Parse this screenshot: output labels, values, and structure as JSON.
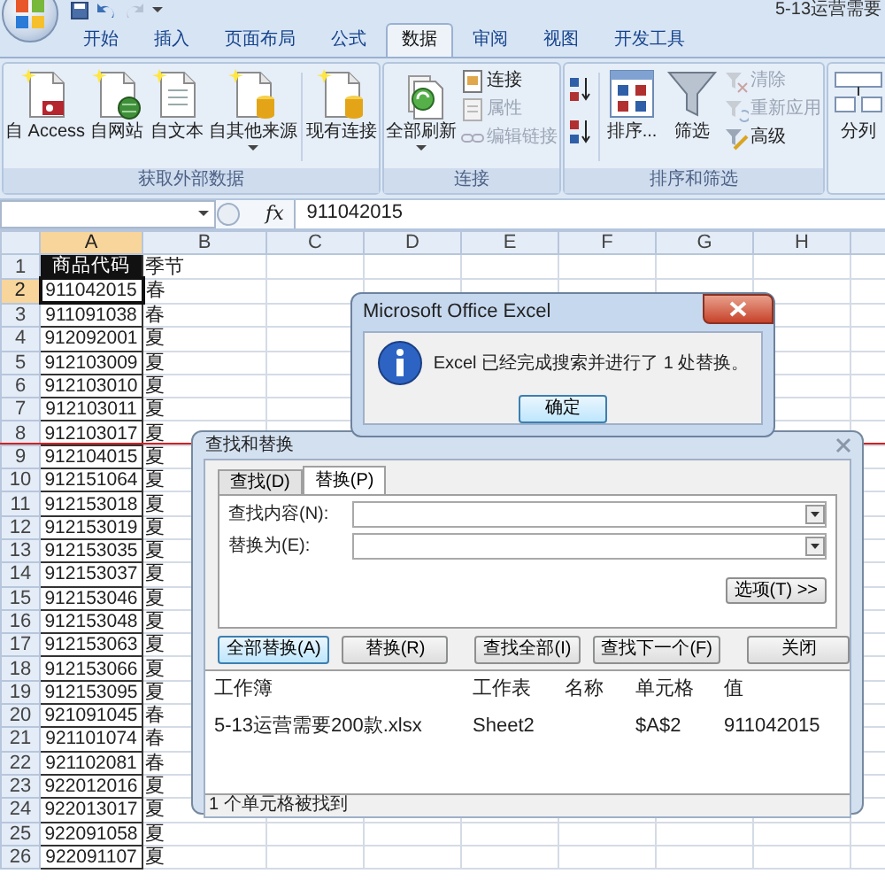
{
  "title_bar": {
    "title": "5-13运营需要"
  },
  "ribbon": {
    "tabs": [
      {
        "label": "开始",
        "selected": false
      },
      {
        "label": "插入",
        "selected": false
      },
      {
        "label": "页面布局",
        "selected": false
      },
      {
        "label": "公式",
        "selected": false
      },
      {
        "label": "数据",
        "selected": true
      },
      {
        "label": "审阅",
        "selected": false
      },
      {
        "label": "视图",
        "selected": false
      },
      {
        "label": "开发工具",
        "selected": false
      }
    ],
    "groups": [
      {
        "label": "获取外部数据",
        "items": [
          {
            "kind": "large",
            "label": "自 Access",
            "dropdown": false
          },
          {
            "kind": "large",
            "label": "自网站",
            "dropdown": false
          },
          {
            "kind": "large",
            "label": "自文本",
            "dropdown": false
          },
          {
            "kind": "large",
            "label": "自其他来源",
            "dropdown": true
          },
          {
            "kind": "large",
            "label": "现有连接",
            "dropdown": false
          }
        ]
      },
      {
        "label": "连接",
        "items": [
          {
            "kind": "large",
            "label": "全部刷新",
            "dropdown": true
          },
          {
            "kind": "stack",
            "items": [
              {
                "label": "连接",
                "disabled": false
              },
              {
                "label": "属性",
                "disabled": true
              },
              {
                "label": "编辑链接",
                "disabled": true
              }
            ]
          }
        ]
      },
      {
        "label": "排序和筛选",
        "items": [
          {
            "kind": "sortpair"
          },
          {
            "kind": "large",
            "label": "排序...",
            "dropdown": false
          },
          {
            "kind": "large",
            "label": "筛选",
            "dropdown": false
          },
          {
            "kind": "stack",
            "items": [
              {
                "label": "清除",
                "disabled": true
              },
              {
                "label": "重新应用",
                "disabled": true
              },
              {
                "label": "高级",
                "disabled": false
              }
            ]
          }
        ]
      },
      {
        "items": [
          {
            "kind": "large",
            "label": "分列",
            "dropdown": false
          }
        ]
      }
    ]
  },
  "formula_bar": {
    "fx_label": "fx",
    "value": "911042015"
  },
  "sheet": {
    "columns": [
      {
        "label": "A",
        "selected": true
      },
      {
        "label": "B",
        "selected": false
      },
      {
        "label": "C",
        "selected": false
      },
      {
        "label": "D",
        "selected": false
      },
      {
        "label": "E",
        "selected": false
      },
      {
        "label": "F",
        "selected": false
      },
      {
        "label": "G",
        "selected": false
      },
      {
        "label": "H",
        "selected": false
      }
    ],
    "rows": [
      {
        "number": "1",
        "kind": "header",
        "selected": false,
        "cells": [
          "商品代码",
          "季节"
        ]
      },
      {
        "number": "2",
        "kind": "data",
        "selected": true,
        "cells": [
          "911042015",
          "春"
        ]
      },
      {
        "number": "3",
        "kind": "data",
        "selected": false,
        "cells": [
          "911091038",
          "春"
        ]
      },
      {
        "number": "4",
        "kind": "data",
        "selected": false,
        "cells": [
          "912092001",
          "夏"
        ]
      },
      {
        "number": "5",
        "kind": "data",
        "selected": false,
        "cells": [
          "912103009",
          "夏"
        ]
      },
      {
        "number": "6",
        "kind": "data",
        "selected": false,
        "cells": [
          "912103010",
          "夏"
        ]
      },
      {
        "number": "7",
        "kind": "data",
        "selected": false,
        "cells": [
          "912103011",
          "夏"
        ]
      },
      {
        "number": "8",
        "kind": "data",
        "selected": false,
        "cells": [
          "912103017",
          "夏"
        ]
      },
      {
        "number": "9",
        "kind": "data",
        "selected": false,
        "cells": [
          "912104015",
          "夏"
        ]
      },
      {
        "number": "10",
        "kind": "data",
        "selected": false,
        "cells": [
          "912151064",
          "夏"
        ]
      },
      {
        "number": "11",
        "kind": "data",
        "selected": false,
        "cells": [
          "912153018",
          "夏"
        ]
      },
      {
        "number": "12",
        "kind": "data",
        "selected": false,
        "cells": [
          "912153019",
          "夏"
        ]
      },
      {
        "number": "13",
        "kind": "data",
        "selected": false,
        "cells": [
          "912153035",
          "夏"
        ]
      },
      {
        "number": "14",
        "kind": "data",
        "selected": false,
        "cells": [
          "912153037",
          "夏"
        ]
      },
      {
        "number": "15",
        "kind": "data",
        "selected": false,
        "cells": [
          "912153046",
          "夏"
        ]
      },
      {
        "number": "16",
        "kind": "data",
        "selected": false,
        "cells": [
          "912153048",
          "夏"
        ]
      },
      {
        "number": "17",
        "kind": "data",
        "selected": false,
        "cells": [
          "912153063",
          "夏"
        ]
      },
      {
        "number": "18",
        "kind": "data",
        "selected": false,
        "cells": [
          "912153066",
          "夏"
        ]
      },
      {
        "number": "19",
        "kind": "data",
        "selected": false,
        "cells": [
          "912153095",
          "夏"
        ]
      },
      {
        "number": "20",
        "kind": "data",
        "selected": false,
        "cells": [
          "921091045",
          "春"
        ]
      },
      {
        "number": "21",
        "kind": "data",
        "selected": false,
        "cells": [
          "921101074",
          "春"
        ]
      },
      {
        "number": "22",
        "kind": "data",
        "selected": false,
        "cells": [
          "921102081",
          "春"
        ]
      },
      {
        "number": "23",
        "kind": "data",
        "selected": false,
        "cells": [
          "922012016",
          "夏"
        ]
      },
      {
        "number": "24",
        "kind": "data",
        "selected": false,
        "cells": [
          "922013017",
          "夏"
        ]
      },
      {
        "number": "25",
        "kind": "data",
        "selected": false,
        "cells": [
          "922091058",
          "夏"
        ]
      },
      {
        "number": "26",
        "kind": "data",
        "selected": false,
        "cells": [
          "922091107",
          "夏"
        ]
      }
    ]
  },
  "message_box": {
    "title": "Microsoft Office Excel",
    "message": "Excel 已经完成搜索并进行了 1 处替换。",
    "button": "确定"
  },
  "find_dialog": {
    "title": "查找和替换",
    "tabs": [
      {
        "label": "查找(D)",
        "selected": false
      },
      {
        "label": "替换(P)",
        "selected": true
      }
    ],
    "fields": [
      {
        "label": "查找内容(N):"
      },
      {
        "label": "替换为(E):"
      }
    ],
    "options_button": "选项(T) >>",
    "buttons": [
      {
        "label": "全部替换(A)",
        "focused": true
      },
      {
        "label": "替换(R)",
        "focused": false
      },
      {
        "label": "查找全部(I)",
        "focused": false
      },
      {
        "label": "查找下一个(F)",
        "focused": false
      },
      {
        "label": "关闭",
        "focused": false
      }
    ],
    "results": {
      "columns": [
        "工作簿",
        "工作表",
        "名称",
        "单元格",
        "值"
      ],
      "rows": [
        {
          "workbook": "5-13运营需要200款.xlsx",
          "worksheet": "Sheet2",
          "cell": "$A$2",
          "value": "911042015"
        }
      ]
    },
    "status": "1 个单元格被找到"
  }
}
